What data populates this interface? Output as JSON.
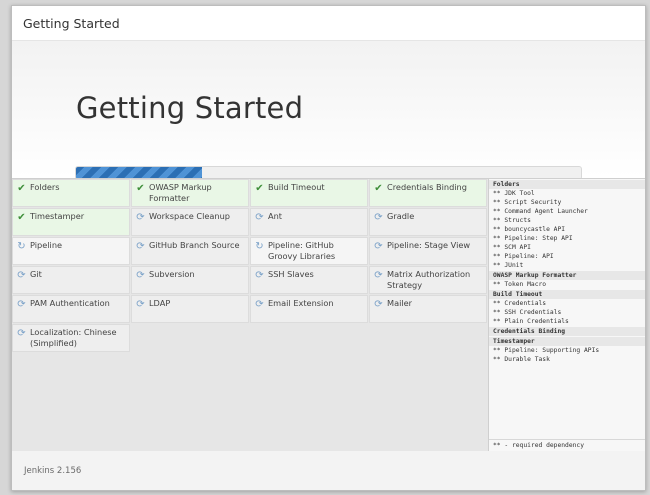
{
  "header": {
    "title": "Getting Started"
  },
  "hero": {
    "title": "Getting Started",
    "progress_percent": 25
  },
  "plugins": [
    {
      "label": "Folders",
      "status": "done",
      "icon": "check-icon"
    },
    {
      "label": "OWASP Markup Formatter",
      "status": "done",
      "icon": "check-icon"
    },
    {
      "label": "Build Timeout",
      "status": "done",
      "icon": "check-icon"
    },
    {
      "label": "Credentials Binding",
      "status": "done",
      "icon": "check-icon"
    },
    {
      "label": "Timestamper",
      "status": "done",
      "icon": "check-icon"
    },
    {
      "label": "Workspace Cleanup",
      "status": "pending",
      "icon": "refresh-icon"
    },
    {
      "label": "Ant",
      "status": "pending",
      "icon": "refresh-icon"
    },
    {
      "label": "Gradle",
      "status": "pending",
      "icon": "refresh-icon"
    },
    {
      "label": "Pipeline",
      "status": "loading",
      "icon": "spinner-icon"
    },
    {
      "label": "GitHub Branch Source",
      "status": "pending",
      "icon": "refresh-icon"
    },
    {
      "label": "Pipeline: GitHub Groovy Libraries",
      "status": "loading",
      "icon": "spinner-icon"
    },
    {
      "label": "Pipeline: Stage View",
      "status": "pending",
      "icon": "refresh-icon"
    },
    {
      "label": "Git",
      "status": "pending",
      "icon": "refresh-icon"
    },
    {
      "label": "Subversion",
      "status": "pending",
      "icon": "refresh-icon"
    },
    {
      "label": "SSH Slaves",
      "status": "pending",
      "icon": "refresh-icon"
    },
    {
      "label": "Matrix Authorization Strategy",
      "status": "pending",
      "icon": "refresh-icon"
    },
    {
      "label": "PAM Authentication",
      "status": "pending",
      "icon": "refresh-icon"
    },
    {
      "label": "LDAP",
      "status": "pending",
      "icon": "refresh-icon"
    },
    {
      "label": "Email Extension",
      "status": "pending",
      "icon": "refresh-icon"
    },
    {
      "label": "Mailer",
      "status": "pending",
      "icon": "refresh-icon"
    },
    {
      "label": "Localization: Chinese (Simplified)",
      "status": "pending",
      "icon": "refresh-icon"
    }
  ],
  "log": {
    "sections": [
      {
        "title": "Folders",
        "lines": [
          "** JDK Tool",
          "** Script Security",
          "** Command Agent Launcher",
          "** Structs",
          "** bouncycastle API",
          "** Pipeline: Step API",
          "** SCM API",
          "** Pipeline: API",
          "** JUnit"
        ]
      },
      {
        "title": "OWASP Markup Formatter",
        "lines": [
          "** Token Macro"
        ]
      },
      {
        "title": "Build Timeout",
        "lines": [
          "** Credentials",
          "** SSH Credentials",
          "** Plain Credentials"
        ]
      },
      {
        "title": "Credentials Binding",
        "lines": []
      },
      {
        "title": "Timestamper",
        "lines": [
          "** Pipeline: Supporting APIs",
          "** Durable Task"
        ]
      }
    ],
    "footer": "** - required dependency"
  },
  "footer": {
    "version": "Jenkins 2.156"
  },
  "colors": {
    "done_bg": "#e9f7e6",
    "check": "#3f8f3a",
    "progress": "#2c6fb4"
  }
}
